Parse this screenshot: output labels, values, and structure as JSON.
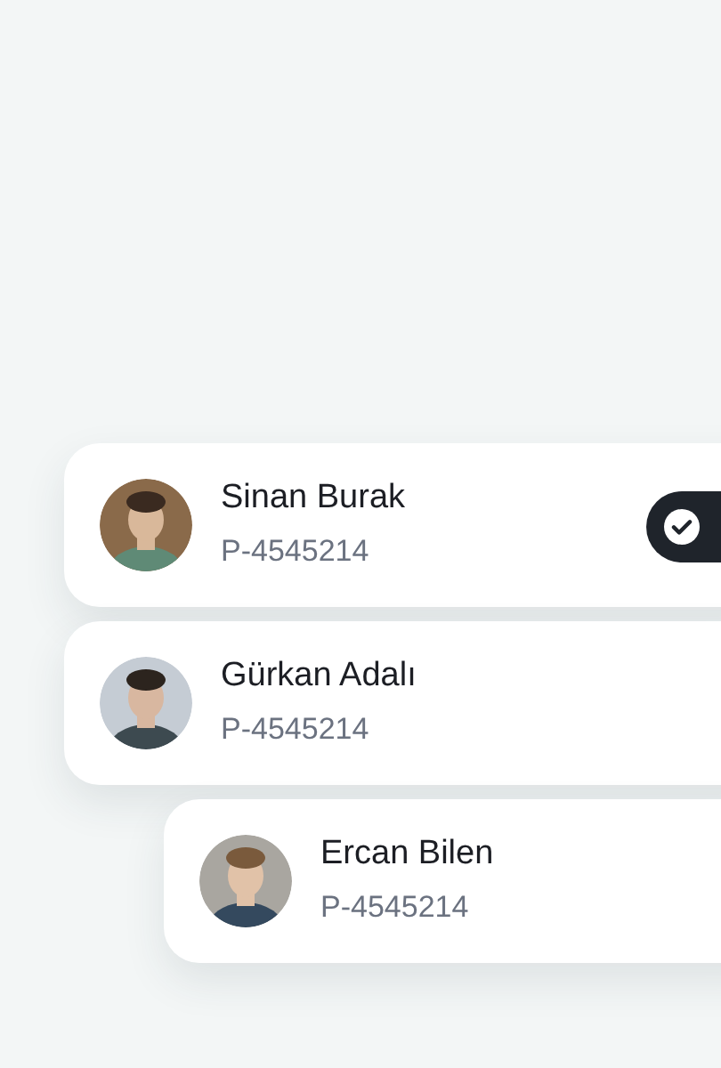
{
  "contacts": [
    {
      "name": "Sinan Burak",
      "code": "P-4545214",
      "selected": true
    },
    {
      "name": "Gürkan Adalı",
      "code": "P-4545214",
      "selected": false
    },
    {
      "name": "Ercan Bilen",
      "code": "P-4545214",
      "selected": false
    }
  ]
}
